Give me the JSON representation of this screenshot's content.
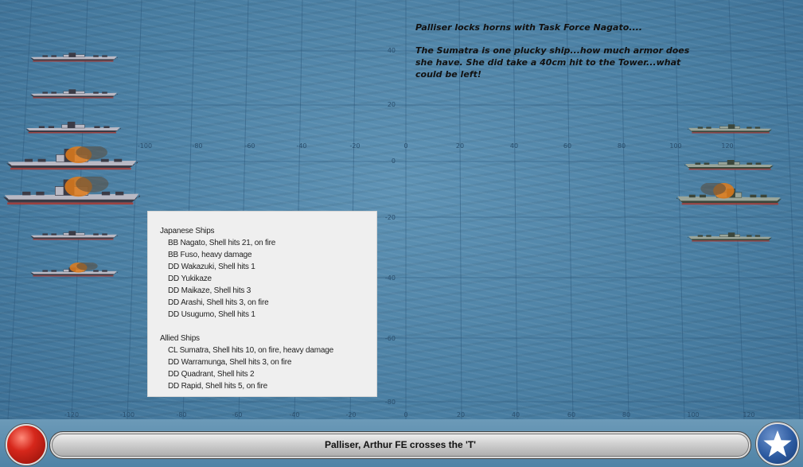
{
  "grid": {
    "x_labels_upper": [
      "-100",
      "-80",
      "-60",
      "-40",
      "-20",
      "0",
      "20",
      "40",
      "60",
      "80",
      "100",
      "120"
    ],
    "x_labels_lower": [
      "-120",
      "-100",
      "-80",
      "-60",
      "-40",
      "-20",
      "0",
      "20",
      "40",
      "60",
      "80",
      "100",
      "120"
    ],
    "y_labels": [
      "40",
      "20",
      "0",
      "-20",
      "-40",
      "-60",
      "-80"
    ]
  },
  "ships": {
    "japanese": [
      {
        "name": "japanese-ship-1",
        "on_fire": false
      },
      {
        "name": "japanese-ship-2",
        "on_fire": false
      },
      {
        "name": "japanese-ship-3",
        "on_fire": false
      },
      {
        "name": "japanese-ship-4",
        "on_fire": true
      },
      {
        "name": "japanese-ship-5",
        "on_fire": true
      },
      {
        "name": "japanese-ship-6",
        "on_fire": false
      },
      {
        "name": "japanese-ship-7",
        "on_fire": true
      }
    ],
    "allied": [
      {
        "name": "allied-ship-1",
        "on_fire": false
      },
      {
        "name": "allied-ship-2",
        "on_fire": false
      },
      {
        "name": "allied-ship-3",
        "on_fire": true
      },
      {
        "name": "allied-ship-4",
        "on_fire": false
      }
    ]
  },
  "narration": {
    "line1": "Palliser locks horns with Task Force Nagato....",
    "line2": "The Sumatra is one plucky ship...how much armor does she have.  She did take a 40cm hit to the Tower...what could be left!"
  },
  "report": {
    "japanese_header": "Japanese Ships",
    "japanese": [
      "BB Nagato, Shell hits 21,  on fire",
      "BB Fuso,  heavy damage",
      "DD Wakazuki, Shell hits 1",
      "DD Yukikaze",
      "DD Maikaze, Shell hits 3",
      "DD Arashi, Shell hits 3,  on fire",
      "DD Usugumo, Shell hits 1"
    ],
    "allied_header": "Allied Ships",
    "allied": [
      "CL Sumatra, Shell hits 10,  on fire,  heavy damage",
      "DD Warramunga, Shell hits 3,  on fire",
      "DD Quadrant, Shell hits 2",
      "DD Rapid, Shell hits 5,  on fire"
    ]
  },
  "status": {
    "message": "Palliser, Arthur FE crosses the 'T'"
  },
  "colors": {
    "sea": "#4a7fa3",
    "japanese_ship_hull": "#b9b9c4",
    "allied_ship_hull": "#9aa59a",
    "fire": "#e07b1a",
    "japan_button": "#d6271b",
    "us_button": "#2c5aa0"
  },
  "icons": {
    "japan_button": "red-rising-sun-disc-icon",
    "us_button": "white-star-roundel-icon"
  }
}
